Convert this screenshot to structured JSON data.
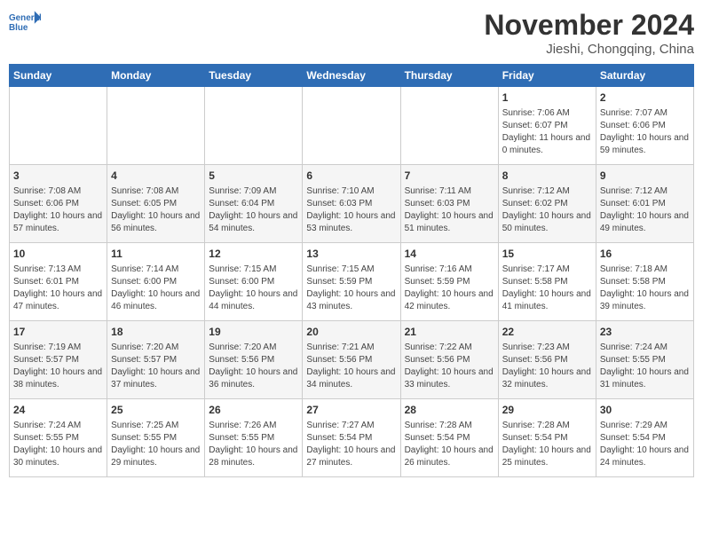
{
  "header": {
    "logo_line1": "General",
    "logo_line2": "Blue",
    "month": "November 2024",
    "location": "Jieshi, Chongqing, China"
  },
  "weekdays": [
    "Sunday",
    "Monday",
    "Tuesday",
    "Wednesday",
    "Thursday",
    "Friday",
    "Saturday"
  ],
  "weeks": [
    [
      {
        "day": "",
        "info": ""
      },
      {
        "day": "",
        "info": ""
      },
      {
        "day": "",
        "info": ""
      },
      {
        "day": "",
        "info": ""
      },
      {
        "day": "",
        "info": ""
      },
      {
        "day": "1",
        "info": "Sunrise: 7:06 AM\nSunset: 6:07 PM\nDaylight: 11 hours and 0 minutes."
      },
      {
        "day": "2",
        "info": "Sunrise: 7:07 AM\nSunset: 6:06 PM\nDaylight: 10 hours and 59 minutes."
      }
    ],
    [
      {
        "day": "3",
        "info": "Sunrise: 7:08 AM\nSunset: 6:06 PM\nDaylight: 10 hours and 57 minutes."
      },
      {
        "day": "4",
        "info": "Sunrise: 7:08 AM\nSunset: 6:05 PM\nDaylight: 10 hours and 56 minutes."
      },
      {
        "day": "5",
        "info": "Sunrise: 7:09 AM\nSunset: 6:04 PM\nDaylight: 10 hours and 54 minutes."
      },
      {
        "day": "6",
        "info": "Sunrise: 7:10 AM\nSunset: 6:03 PM\nDaylight: 10 hours and 53 minutes."
      },
      {
        "day": "7",
        "info": "Sunrise: 7:11 AM\nSunset: 6:03 PM\nDaylight: 10 hours and 51 minutes."
      },
      {
        "day": "8",
        "info": "Sunrise: 7:12 AM\nSunset: 6:02 PM\nDaylight: 10 hours and 50 minutes."
      },
      {
        "day": "9",
        "info": "Sunrise: 7:12 AM\nSunset: 6:01 PM\nDaylight: 10 hours and 49 minutes."
      }
    ],
    [
      {
        "day": "10",
        "info": "Sunrise: 7:13 AM\nSunset: 6:01 PM\nDaylight: 10 hours and 47 minutes."
      },
      {
        "day": "11",
        "info": "Sunrise: 7:14 AM\nSunset: 6:00 PM\nDaylight: 10 hours and 46 minutes."
      },
      {
        "day": "12",
        "info": "Sunrise: 7:15 AM\nSunset: 6:00 PM\nDaylight: 10 hours and 44 minutes."
      },
      {
        "day": "13",
        "info": "Sunrise: 7:15 AM\nSunset: 5:59 PM\nDaylight: 10 hours and 43 minutes."
      },
      {
        "day": "14",
        "info": "Sunrise: 7:16 AM\nSunset: 5:59 PM\nDaylight: 10 hours and 42 minutes."
      },
      {
        "day": "15",
        "info": "Sunrise: 7:17 AM\nSunset: 5:58 PM\nDaylight: 10 hours and 41 minutes."
      },
      {
        "day": "16",
        "info": "Sunrise: 7:18 AM\nSunset: 5:58 PM\nDaylight: 10 hours and 39 minutes."
      }
    ],
    [
      {
        "day": "17",
        "info": "Sunrise: 7:19 AM\nSunset: 5:57 PM\nDaylight: 10 hours and 38 minutes."
      },
      {
        "day": "18",
        "info": "Sunrise: 7:20 AM\nSunset: 5:57 PM\nDaylight: 10 hours and 37 minutes."
      },
      {
        "day": "19",
        "info": "Sunrise: 7:20 AM\nSunset: 5:56 PM\nDaylight: 10 hours and 36 minutes."
      },
      {
        "day": "20",
        "info": "Sunrise: 7:21 AM\nSunset: 5:56 PM\nDaylight: 10 hours and 34 minutes."
      },
      {
        "day": "21",
        "info": "Sunrise: 7:22 AM\nSunset: 5:56 PM\nDaylight: 10 hours and 33 minutes."
      },
      {
        "day": "22",
        "info": "Sunrise: 7:23 AM\nSunset: 5:56 PM\nDaylight: 10 hours and 32 minutes."
      },
      {
        "day": "23",
        "info": "Sunrise: 7:24 AM\nSunset: 5:55 PM\nDaylight: 10 hours and 31 minutes."
      }
    ],
    [
      {
        "day": "24",
        "info": "Sunrise: 7:24 AM\nSunset: 5:55 PM\nDaylight: 10 hours and 30 minutes."
      },
      {
        "day": "25",
        "info": "Sunrise: 7:25 AM\nSunset: 5:55 PM\nDaylight: 10 hours and 29 minutes."
      },
      {
        "day": "26",
        "info": "Sunrise: 7:26 AM\nSunset: 5:55 PM\nDaylight: 10 hours and 28 minutes."
      },
      {
        "day": "27",
        "info": "Sunrise: 7:27 AM\nSunset: 5:54 PM\nDaylight: 10 hours and 27 minutes."
      },
      {
        "day": "28",
        "info": "Sunrise: 7:28 AM\nSunset: 5:54 PM\nDaylight: 10 hours and 26 minutes."
      },
      {
        "day": "29",
        "info": "Sunrise: 7:28 AM\nSunset: 5:54 PM\nDaylight: 10 hours and 25 minutes."
      },
      {
        "day": "30",
        "info": "Sunrise: 7:29 AM\nSunset: 5:54 PM\nDaylight: 10 hours and 24 minutes."
      }
    ]
  ]
}
